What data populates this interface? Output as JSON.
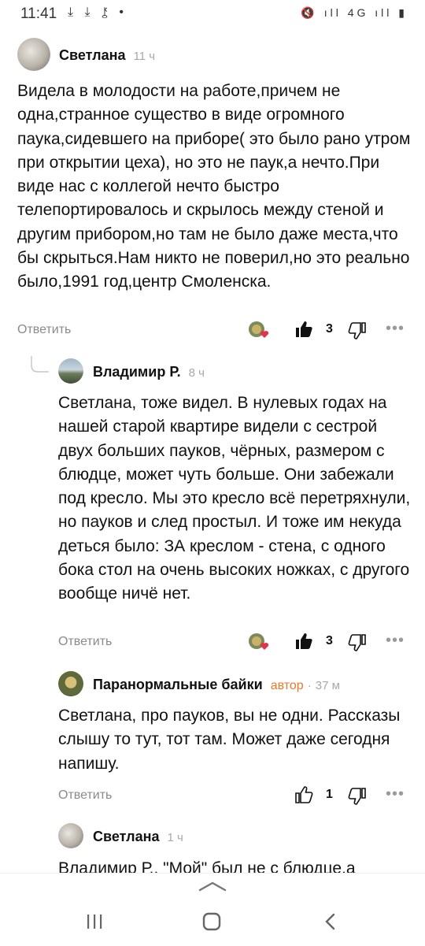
{
  "status": {
    "time": "11:41",
    "left_icons": "⤓ ⤓ ⚷ •",
    "right_icons": "🔇 ıll 4G ıll ▮"
  },
  "comments": [
    {
      "author": "Светлана",
      "time": "11 ч",
      "text": "Видела в молодости на работе,причем не одна,странное существо в виде огромного паука,сидевшего на приборе( это было рано утром при открытии цеха), но это не паук,а нечто.При виде нас с коллегой нечто быстро телепортировалось и скрылось между стеной и другим прибором,но там не было даже места,что бы скрыться.Нам никто не поверил,но это реально было,1991 год,центр Смоленска.",
      "reply_label": "Ответить",
      "likes": "3"
    },
    {
      "author": "Владимир Р.",
      "time": "8 ч",
      "text": "Светлана, тоже видел. В нулевых годах на нашей старой квартире видели с сестрой двух больших пауков, чёрных, размером с блюдце, может чуть больше. Они забежали под кресло. Мы это кресло всё перетряхнули, но пауков и след простыл. И тоже им некуда деться было: ЗА креслом - стена, с одного бока стол на очень высоких ножках, с другого вообще ничё нет.",
      "reply_label": "Ответить",
      "likes": "3"
    },
    {
      "author": "Паранормальные байки",
      "badge": "автор",
      "separator": "·",
      "time": "37 м",
      "text": "Светлана, про пауков, вы не одни. Рассказы слышу то тут, тот там. Может даже сегодня напишу.",
      "reply_label": "Ответить",
      "likes": "1"
    },
    {
      "author": "Светлана",
      "time": "1 ч",
      "text": "Владимир Р., \"Мой\" был не с блюдце,а"
    }
  ],
  "colors": {
    "accent": "#e8782a",
    "muted": "#a8a8a8",
    "text": "#111111"
  },
  "icons": [
    "thumbs-up-icon",
    "thumbs-down-icon",
    "more-icon",
    "reactions-avatar-icon",
    "heart-icon",
    "nav-recent-icon",
    "nav-home-icon",
    "nav-back-icon",
    "chevron-up-icon"
  ]
}
